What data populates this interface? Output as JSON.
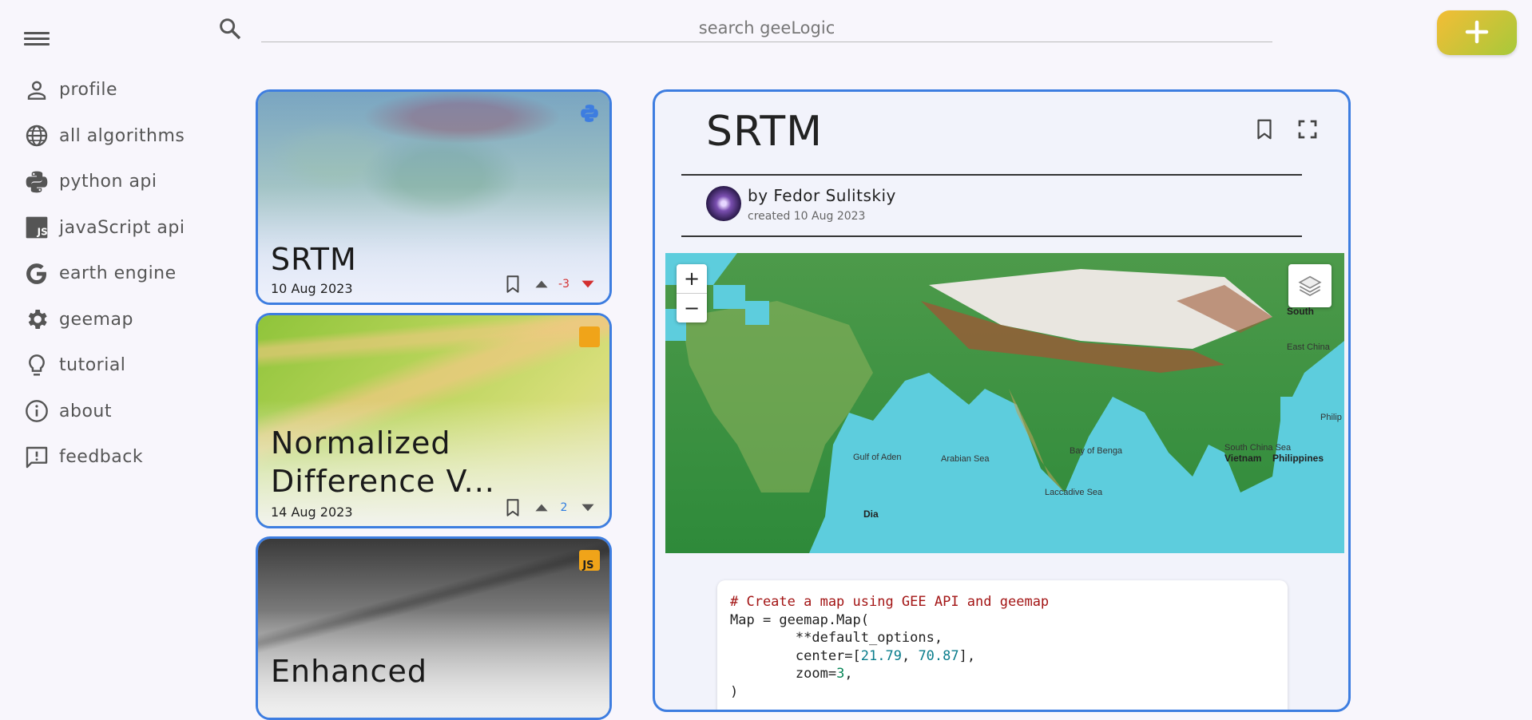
{
  "sidebar": {
    "items": [
      {
        "label": "profile",
        "icon": "person-icon"
      },
      {
        "label": "all algorithms",
        "icon": "globe-icon"
      },
      {
        "label": "python api",
        "icon": "python-icon"
      },
      {
        "label": "javaScript api",
        "icon": "javascript-icon"
      },
      {
        "label": "earth engine",
        "icon": "google-g-icon"
      },
      {
        "label": "geemap",
        "icon": "gear-icon"
      },
      {
        "label": "tutorial",
        "icon": "lightbulb-icon"
      },
      {
        "label": "about",
        "icon": "info-icon"
      },
      {
        "label": "feedback",
        "icon": "feedback-icon"
      }
    ]
  },
  "search": {
    "placeholder": "search geeLogic"
  },
  "add_button": {
    "icon": "plus-icon",
    "color": "#f3bd36"
  },
  "cards": [
    {
      "title": "SRTM",
      "date": "10 Aug 2023",
      "votes": "-3",
      "lang": "python",
      "vote_color": "#d32f2f"
    },
    {
      "title": "Normalized Difference V...",
      "date": "14 Aug 2023",
      "votes": "2",
      "lang": "js",
      "vote_color": "#2f7de0"
    },
    {
      "title": "Enhanced",
      "date": "",
      "votes": "",
      "lang": "js"
    }
  ],
  "detail": {
    "title": "SRTM",
    "author": "by Fedor Sulitskiy",
    "created": "created 10 Aug 2023",
    "map": {
      "zoom_in": "+",
      "zoom_out": "−",
      "labels": [
        "Arabian Sea",
        "Bay of Benga",
        "South China Sea",
        "Philip",
        "Philippines",
        "South",
        "East China",
        "Gulf of Aden",
        "Laccadive Sea",
        "Vietnam",
        "Dia"
      ]
    },
    "code": {
      "comment": "# Create a map using GEE API and geemap",
      "line1": "Map = geemap.Map(",
      "line2": "        **default_options,",
      "line3_prefix": "        center=[",
      "lat": "21.79",
      "lon": "70.87",
      "line3_suffix": "],",
      "line4_prefix": "        zoom=",
      "zoom": "3",
      "line4_suffix": ",",
      "line5": ")"
    }
  },
  "colors": {
    "accent": "#3d7de0",
    "down_vote": "#d32f2f",
    "up_vote": "#2f7de0"
  }
}
